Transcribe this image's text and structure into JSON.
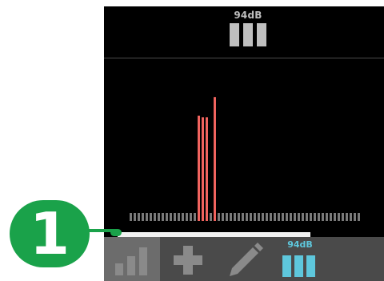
{
  "meter": {
    "level_label": "94dB",
    "level_bars": 3
  },
  "spectrum": {
    "bar_color": "#f0635e",
    "band_count": 58,
    "peaks": [
      {
        "band": 17,
        "value": 0.73
      },
      {
        "band": 18,
        "value": 0.72
      },
      {
        "band": 19,
        "value": 0.72
      },
      {
        "band": 21,
        "value": 0.86
      }
    ]
  },
  "toolbar": {
    "items": [
      {
        "name": "bars-icon",
        "active": true
      },
      {
        "name": "plus-icon",
        "active": false
      },
      {
        "name": "pencil-icon",
        "active": false
      },
      {
        "name": "level",
        "label": "94dB",
        "active": false
      }
    ]
  },
  "callout": {
    "number": "1",
    "color": "#1aa24a"
  },
  "colors": {
    "accent": "#5ec7dc",
    "callout": "#1aa24a"
  }
}
